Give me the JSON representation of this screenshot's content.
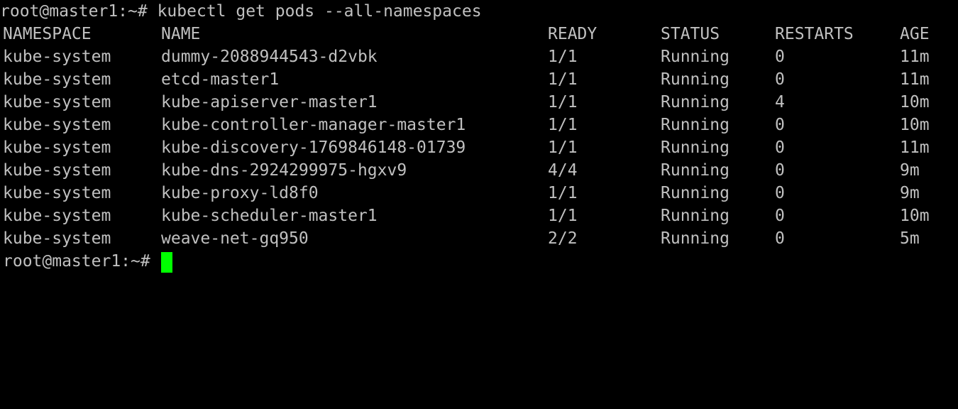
{
  "terminal": {
    "command_line": {
      "prompt": "root@master1:~#",
      "command": "kubectl get pods --all-namespaces"
    },
    "headers": {
      "namespace": "NAMESPACE",
      "name": "NAME",
      "ready": "READY",
      "status": "STATUS",
      "restarts": "RESTARTS",
      "age": "AGE"
    },
    "rows": [
      {
        "namespace": "kube-system",
        "name": "dummy-2088944543-d2vbk",
        "ready": "1/1",
        "status": "Running",
        "restarts": "0",
        "age": "11m"
      },
      {
        "namespace": "kube-system",
        "name": "etcd-master1",
        "ready": "1/1",
        "status": "Running",
        "restarts": "0",
        "age": "11m"
      },
      {
        "namespace": "kube-system",
        "name": "kube-apiserver-master1",
        "ready": "1/1",
        "status": "Running",
        "restarts": "4",
        "age": "10m"
      },
      {
        "namespace": "kube-system",
        "name": "kube-controller-manager-master1",
        "ready": "1/1",
        "status": "Running",
        "restarts": "0",
        "age": "10m"
      },
      {
        "namespace": "kube-system",
        "name": "kube-discovery-1769846148-01739",
        "ready": "1/1",
        "status": "Running",
        "restarts": "0",
        "age": "11m"
      },
      {
        "namespace": "kube-system",
        "name": "kube-dns-2924299975-hgxv9",
        "ready": "4/4",
        "status": "Running",
        "restarts": "0",
        "age": "9m"
      },
      {
        "namespace": "kube-system",
        "name": "kube-proxy-ld8f0",
        "ready": "1/1",
        "status": "Running",
        "restarts": "0",
        "age": "9m"
      },
      {
        "namespace": "kube-system",
        "name": "kube-scheduler-master1",
        "ready": "1/1",
        "status": "Running",
        "restarts": "0",
        "age": "10m"
      },
      {
        "namespace": "kube-system",
        "name": "weave-net-gq950",
        "ready": "2/2",
        "status": "Running",
        "restarts": "0",
        "age": "5m"
      }
    ],
    "final_prompt": "root@master1:~#",
    "colors": {
      "background": "#000000",
      "text": "#c0c0c0",
      "cursor": "#00ff00"
    }
  }
}
